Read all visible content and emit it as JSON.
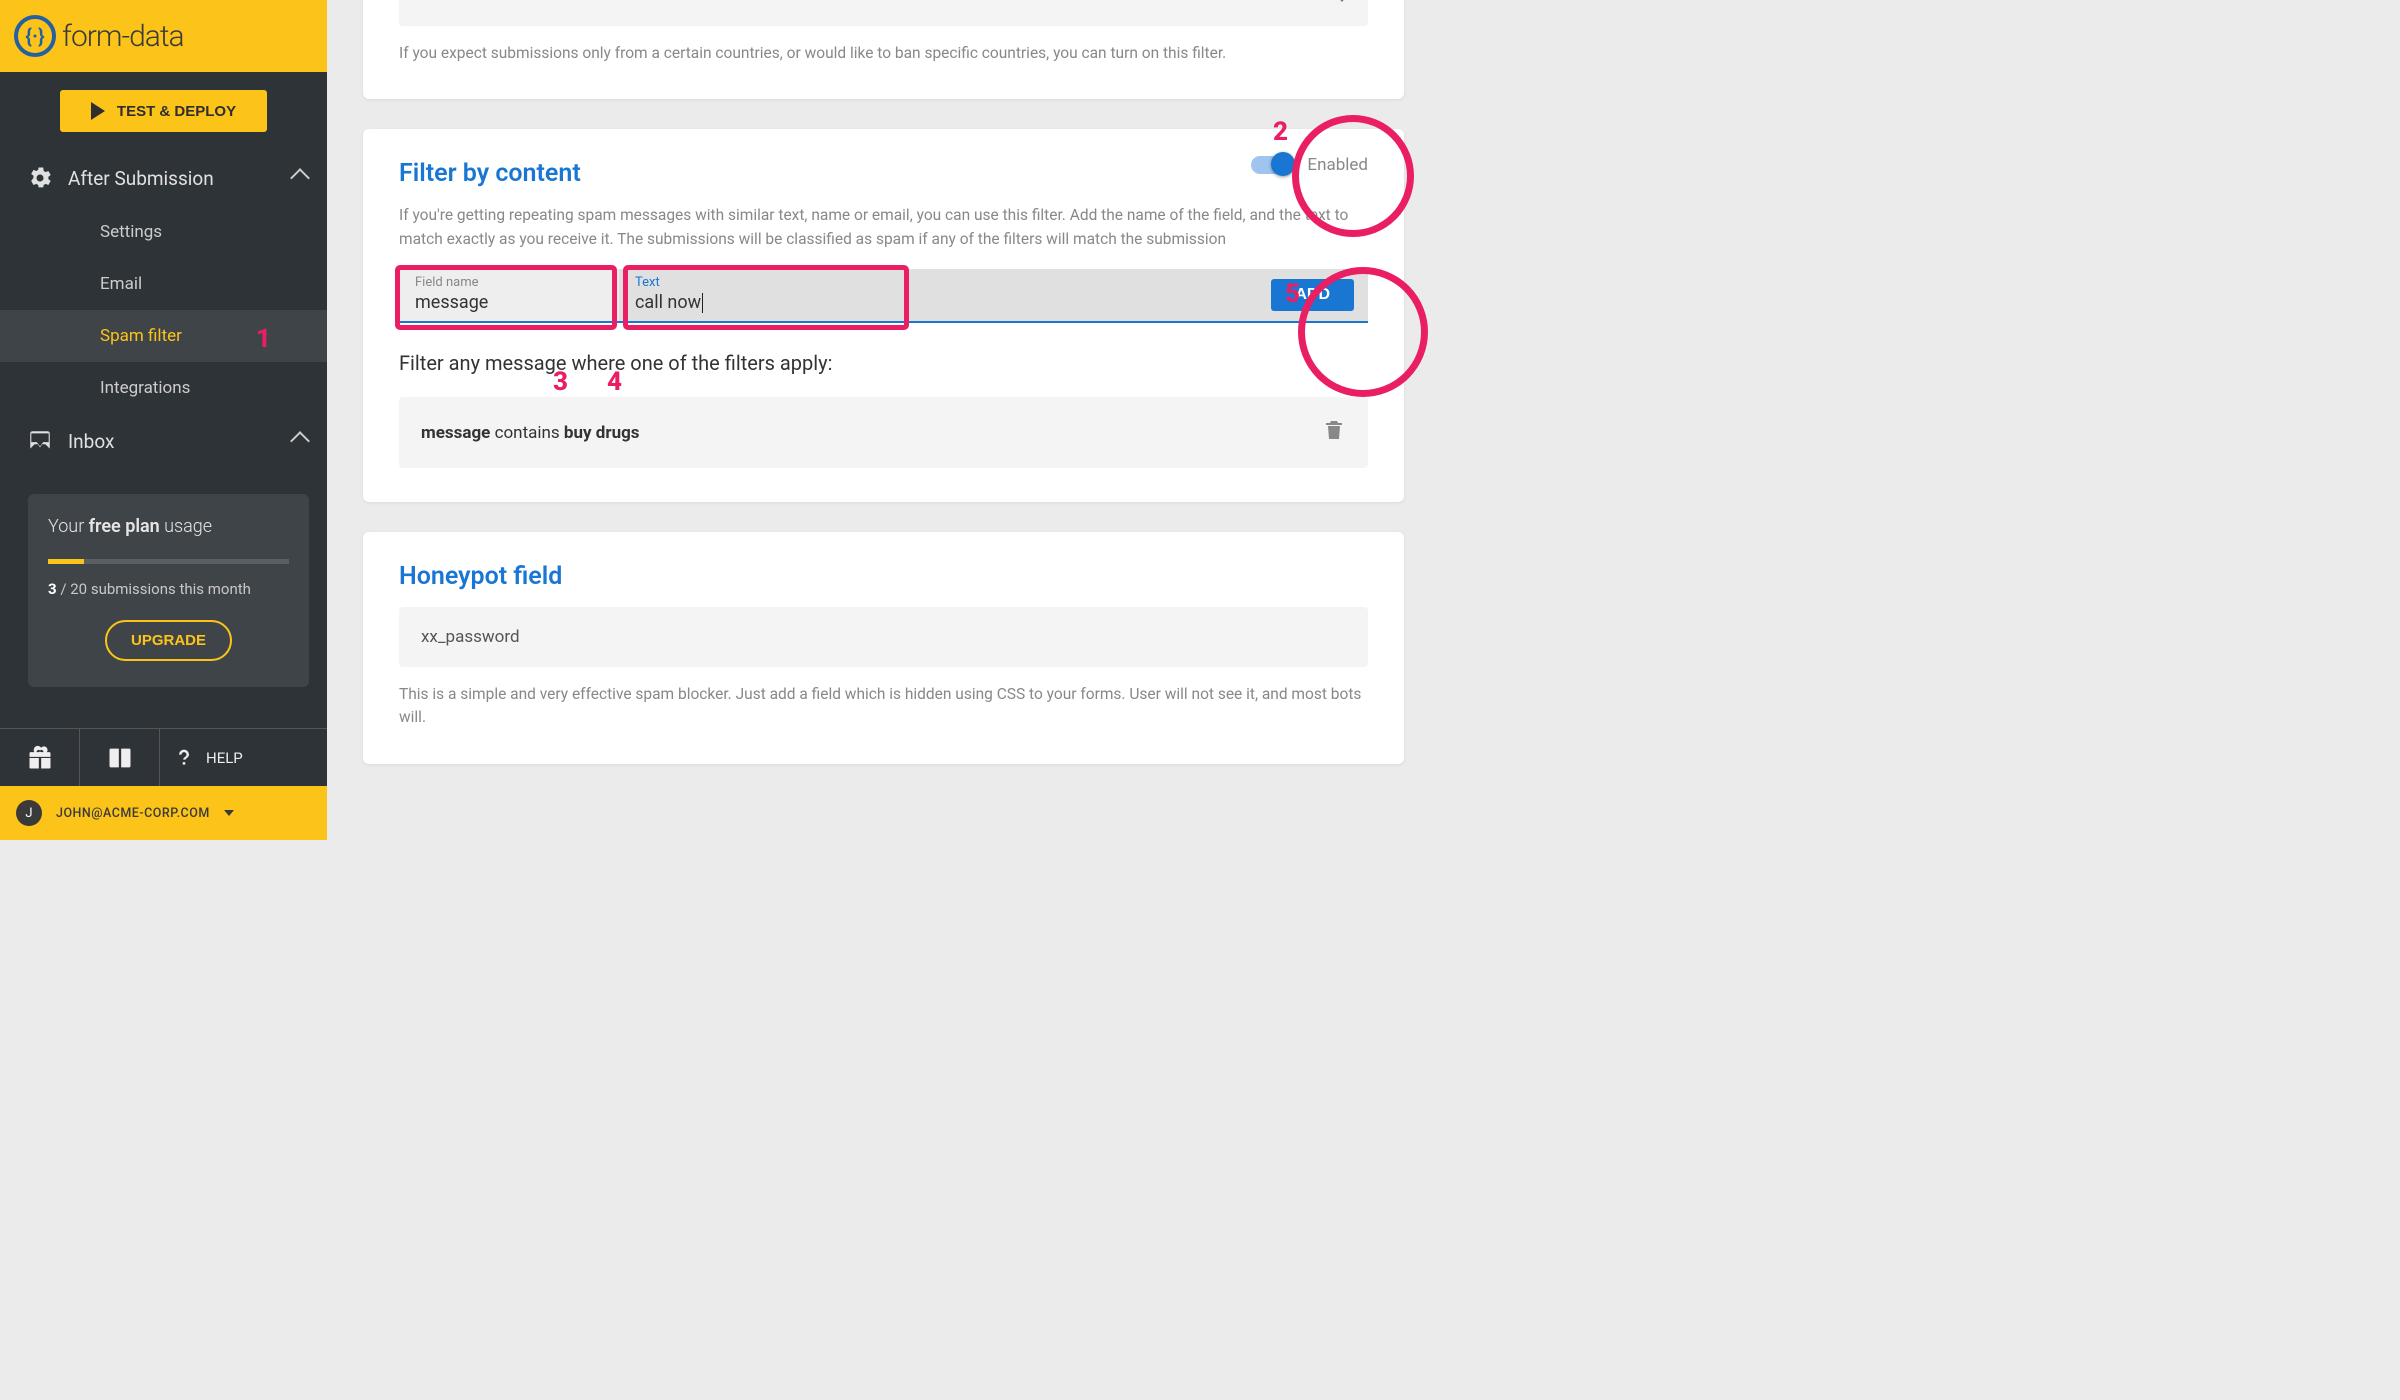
{
  "brand": "form-data",
  "deploy_label": "TEST & DEPLOY",
  "nav": {
    "after_submission": "After Submission",
    "settings": "Settings",
    "email": "Email",
    "spam_filter": "Spam filter",
    "integrations": "Integrations",
    "inbox": "Inbox"
  },
  "plan": {
    "title_pre": "Your ",
    "title_bold": "free plan",
    "title_post": " usage",
    "count": "3",
    "rest": " / 20 submissions this month",
    "upgrade": "UPGRADE"
  },
  "help_label": "HELP",
  "user": {
    "initial": "J",
    "email": "JOHN@ACME-CORP.COM"
  },
  "card_country": {
    "help": "If you expect submissions only from a certain countries, or would like to ban specific countries, you can turn on this filter."
  },
  "card_content": {
    "title": "Filter by content",
    "toggle_label": "Enabled",
    "help": "If you're getting repeating spam messages with similar text, name or email, you can use this filter. Add the name of the field, and the text to match exactly as you receive it. The submissions will be classified as spam if any of the filters will match the submission",
    "field_label": "Field name",
    "field_value": "message",
    "text_label": "Text",
    "text_value": "call now",
    "add": "ADD",
    "filter_heading": "Filter any message where one of the filters apply:",
    "rule_field": "message",
    "rule_verb": " contains ",
    "rule_text": "buy drugs"
  },
  "card_honeypot": {
    "title": "Honeypot field",
    "value": "xx_password",
    "help": "This is a simple and very effective spam blocker. Just add a field which is hidden using CSS to your forms. User will not see it, and most bots will."
  },
  "annotations": {
    "n1": "1",
    "n2": "2",
    "n3": "3",
    "n4": "4",
    "n5": "5"
  }
}
